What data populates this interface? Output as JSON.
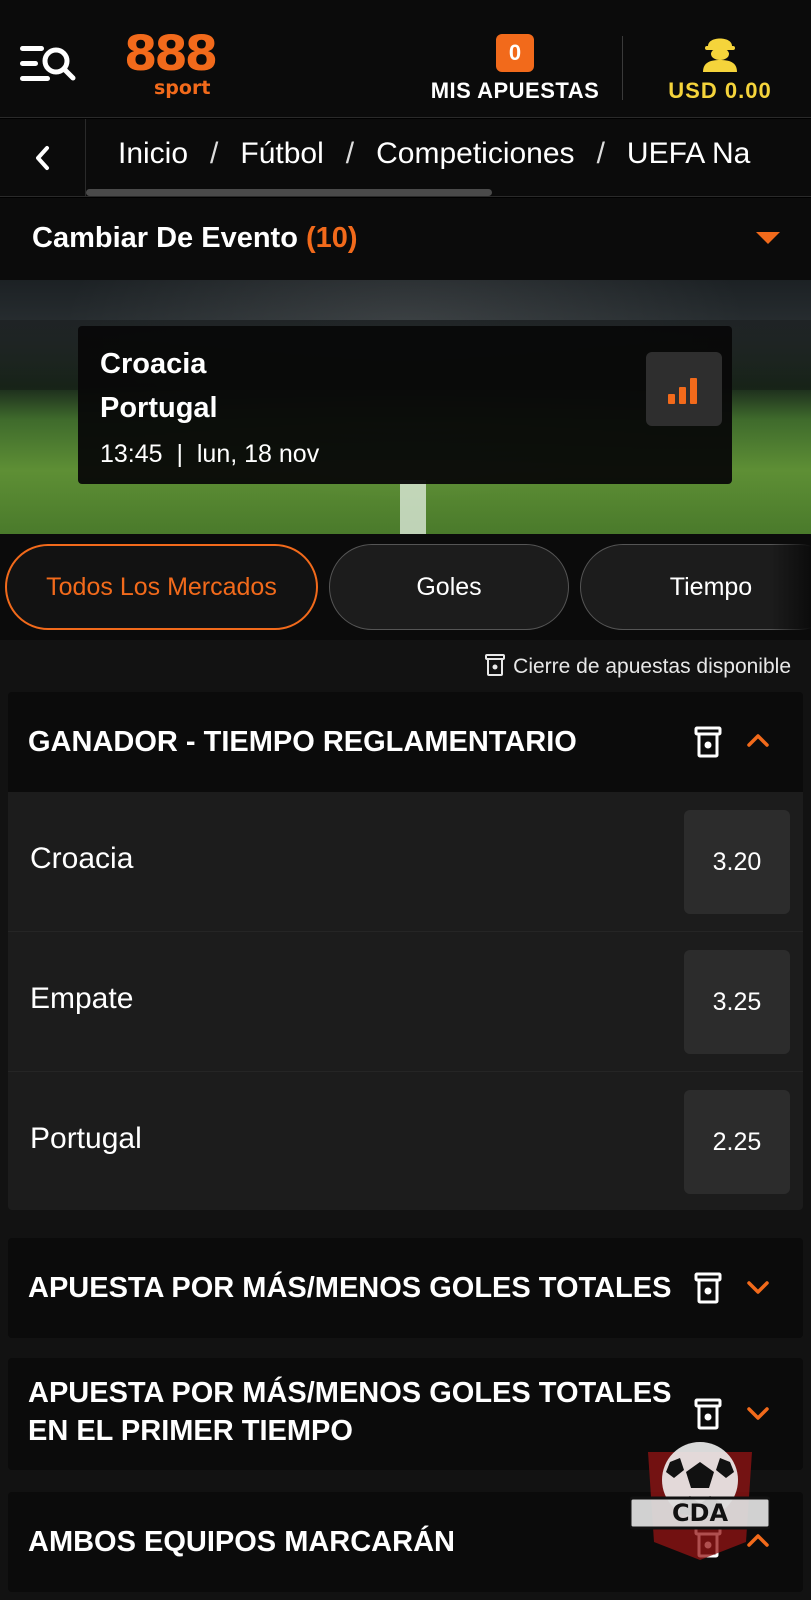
{
  "header": {
    "logo_number": "888",
    "logo_word": "sport",
    "bets_count": "0",
    "bets_label": "MIS APUESTAS",
    "balance": "USD 0.00"
  },
  "breadcrumb": {
    "items": [
      "Inicio",
      "Fútbol",
      "Competiciones",
      "UEFA Na"
    ],
    "separator": "/"
  },
  "event_switcher": {
    "label": "Cambiar De Evento",
    "count": "(10)"
  },
  "event": {
    "home_team": "Croacia",
    "away_team": "Portugal",
    "time": "13:45",
    "divider": "|",
    "date": "lun, 18 nov"
  },
  "filters": [
    {
      "label": "Todos Los Mercados",
      "active": true
    },
    {
      "label": "Goles",
      "active": false
    },
    {
      "label": "Tiempo",
      "active": false
    }
  ],
  "cashout_note": "Cierre de apuestas disponible",
  "markets": [
    {
      "title": "GANADOR - TIEMPO REGLAMENTARIO",
      "expanded": true,
      "outcomes": [
        {
          "name": "Croacia",
          "odds": "3.20"
        },
        {
          "name": "Empate",
          "odds": "3.25"
        },
        {
          "name": "Portugal",
          "odds": "2.25"
        }
      ]
    },
    {
      "title": "APUESTA POR MÁS/MENOS GOLES TOTALES",
      "expanded": false
    },
    {
      "title_line1": "APUESTA POR MÁS/MENOS GOLES TOTALES",
      "title_line2": "EN EL PRIMER TIEMPO",
      "expanded": false
    },
    {
      "title": "AMBOS EQUIPOS MARCARÁN",
      "expanded": true
    }
  ],
  "watermark": {
    "text": "CDA"
  },
  "colors": {
    "accent": "#f26a1b",
    "balance": "#f5d43b",
    "background": "#0b0b0b",
    "panel": "#1c1c1c",
    "odds_button": "#2c2c2c"
  },
  "icons": [
    "menu-search-icon",
    "user-icon",
    "chevron-left-icon",
    "caret-down-icon",
    "stats-icon",
    "cashout-icon",
    "chevron-up-icon",
    "chevron-down-icon"
  ]
}
